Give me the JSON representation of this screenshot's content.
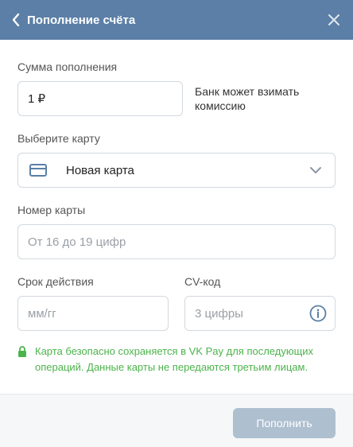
{
  "header": {
    "title": "Пополнение счёта",
    "back_icon": "chevron-left-icon",
    "close_icon": "close-icon",
    "background": "#5b7fa6"
  },
  "amount": {
    "label": "Сумма пополнения",
    "value": "1 ₽",
    "note": "Банк может взимать комиссию"
  },
  "card_select": {
    "label": "Выберите карту",
    "selected": "Новая карта",
    "icon": "credit-card-icon"
  },
  "card_number": {
    "label": "Номер карты",
    "placeholder": "От 16 до 19 цифр"
  },
  "expiry": {
    "label": "Срок действия",
    "placeholder": "мм/гг"
  },
  "cvv": {
    "label": "CV-код",
    "placeholder": "3 цифры",
    "icon": "info-icon"
  },
  "security_note": {
    "text": "Карта безопасно сохраняется в VK Pay для последующих операций. Данные карты не передаются третьим лицам.",
    "color": "#4bb34b",
    "icon": "lock-icon"
  },
  "footer": {
    "submit_label": "Пополнить",
    "submit_color": "#aebfd0"
  }
}
